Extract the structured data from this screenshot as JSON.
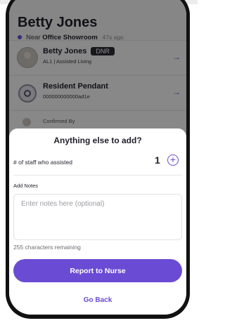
{
  "resident": {
    "name": "Betty Jones",
    "near_prefix": "Near",
    "location": "Office Showroom",
    "time_ago": "47s ago"
  },
  "cards": [
    {
      "title": "Betty Jones",
      "badge": "DNR",
      "subtitle": "AL1 | Assisted Living",
      "icon": "avatar"
    },
    {
      "title": "Resident Pendant",
      "subtitle": "000000000000ad1e",
      "icon": "pendant-icon"
    },
    {
      "title": "Confirmed By"
    }
  ],
  "sheet": {
    "title": "Anything else to add?",
    "staff_label": "# of staff who assisted",
    "staff_count": "1",
    "notes_label": "Add Notes",
    "notes_placeholder": "Enter notes here (optional)",
    "notes_value": "",
    "remaining": "255 characters remaining",
    "report_label": "Report to Nurse",
    "back_label": "Go Back"
  },
  "colors": {
    "accent": "#6a4bd4",
    "dark": "#1f1f2b",
    "badge_bg": "#2c2c34"
  }
}
